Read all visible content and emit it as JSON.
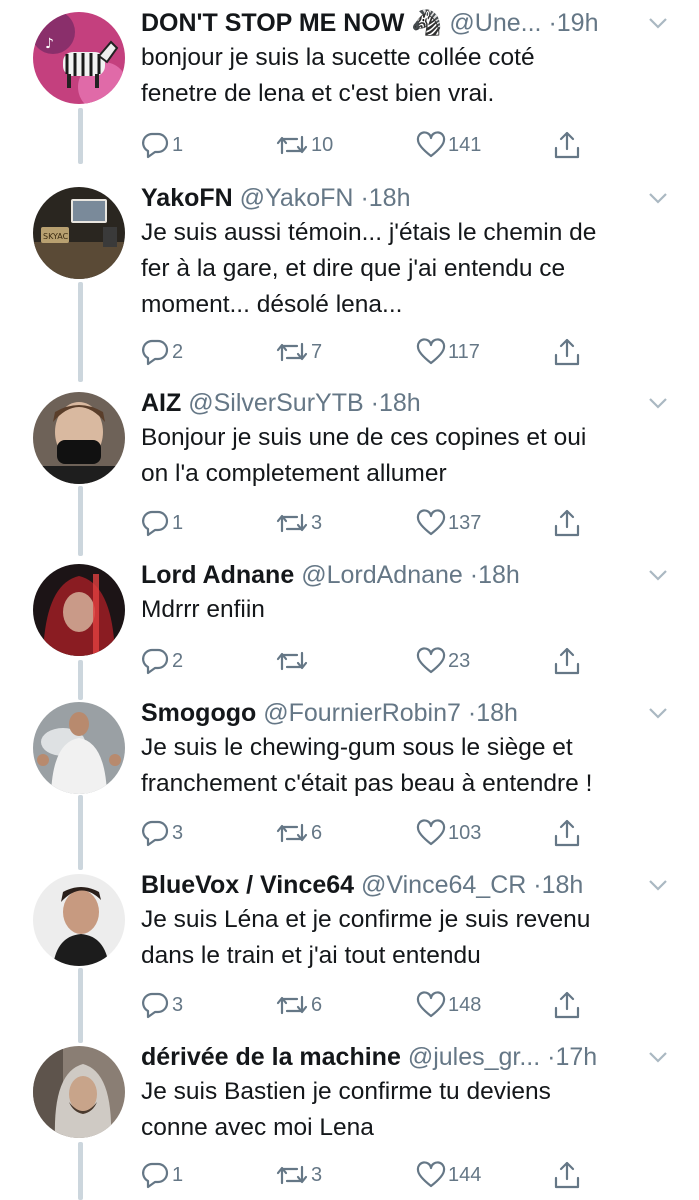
{
  "colors": {
    "text": "#14171a",
    "muted": "#657786",
    "thread_line": "#ccd6dd"
  },
  "icons": {
    "reply": "reply-icon",
    "retweet": "retweet-icon",
    "like": "heart-icon",
    "share": "share-icon",
    "menu": "chevron-down-icon"
  },
  "tweets": [
    {
      "name": "DON'T STOP ME NOW 🦓",
      "handle": "@Une...",
      "time": "19h",
      "lines": [
        "bonjour je suis la sucette collée coté",
        "fenetre de lena et c'est bien vrai."
      ],
      "replies": "1",
      "retweets": "10",
      "likes": "141"
    },
    {
      "name": "YakoFN",
      "handle": "@YakoFN",
      "time": "18h",
      "lines": [
        "Je suis aussi témoin... j'étais le chemin de",
        "fer à la gare, et dire que j'ai entendu ce",
        "moment... désolé lena..."
      ],
      "replies": "2",
      "retweets": "7",
      "likes": "117"
    },
    {
      "name": "AIZ",
      "handle": "@SilverSurYTB",
      "time": "18h",
      "lines": [
        "Bonjour je suis une de ces copines et oui",
        "on l'a completement allumer"
      ],
      "replies": "1",
      "retweets": "3",
      "likes": "137"
    },
    {
      "name": "Lord Adnane",
      "handle": "@LordAdnane",
      "time": "18h",
      "lines": [
        "Mdrrr enfiin"
      ],
      "replies": "2",
      "retweets": "",
      "likes": "23"
    },
    {
      "name": "Smogogo",
      "handle": "@FournierRobin7",
      "time": "18h",
      "lines": [
        "Je suis le chewing-gum sous le siège et",
        "franchement c'était pas beau à entendre !"
      ],
      "replies": "3",
      "retweets": "6",
      "likes": "103"
    },
    {
      "name": "BlueVox / Vince64",
      "handle": "@Vince64_CR",
      "time": "18h",
      "lines": [
        "Je suis Léna et je confirme je suis revenu",
        "dans le train et j'ai tout entendu"
      ],
      "replies": "3",
      "retweets": "6",
      "likes": "148"
    },
    {
      "name": "dérivée de la machine",
      "handle": "@jules_gr...",
      "time": "17h",
      "lines": [
        "Je suis Bastien je confirme tu deviens",
        "conne avec moi Lena"
      ],
      "replies": "1",
      "retweets": "3",
      "likes": "144"
    }
  ]
}
